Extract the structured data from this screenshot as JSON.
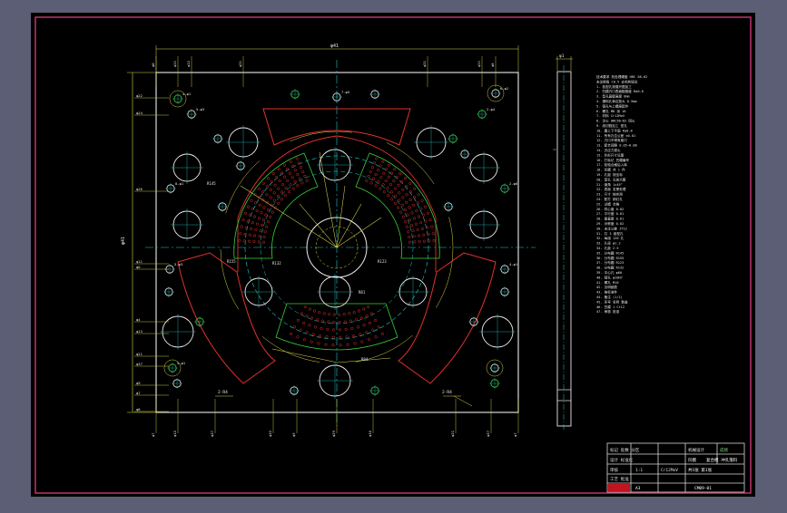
{
  "drawing": {
    "top_width_dim": "φ41",
    "side_width_dim": "φ1",
    "left_height_dim": "φ41",
    "left_bottom_label": "2-R4",
    "right_bottom_label": "2-R4",
    "left_dims": [
      "φ22",
      "φ24",
      "φ26",
      "φ11",
      "φ6",
      "φ4",
      "φ13",
      "φ21",
      "φ37",
      "φ9",
      "φ7",
      "φ8"
    ],
    "top_dims": [
      "φ8",
      "φ11",
      "φ12",
      "φ21",
      "φ21",
      "φ11",
      "φ8"
    ],
    "bottom_dims": [
      "φ7",
      "φ12",
      "φ27",
      "φ22",
      "φ9",
      "φ29",
      "φ10",
      "φ21",
      "φ27",
      "φ7"
    ],
    "hole_labels": [
      "4-φ1",
      "6-φ2",
      "5-φ3",
      "2-φ4",
      "7-φ5",
      "8-φ1",
      "2-φ6",
      "5-φ3",
      "4-φ1",
      "5-φ1"
    ],
    "center_dims": [
      "R145",
      "R155",
      "R123",
      "R132",
      "R81",
      "R84"
    ],
    "notes": [
      "技术要求 热处理硬度 HRC 58-62",
      "未注倒角 C0.5 去毛刺锐边",
      "1. 各型孔按展开图加工",
      "2. 凹模刃口表面粗糙度 Ra0.8",
      "3. 型孔直壁高度 8mm",
      "4. 漏料孔单边放大 0.5mm",
      "5. 销孔与上模座配作",
      "6. 螺孔 M8 深 16",
      "7. 材料 Cr12MoV",
      "8. 淬火 HRC58~62 回火",
      "9. 线切割加工 型孔",
      "10. 磨上下平面 Ra0.8",
      "11. 所有孔位公差 ±0.01",
      "12. 刃口不得有崩刃",
      "13. 配合间隙 0.05~0.08",
      "14. 去应力退火",
      "15. 外形尺寸见图",
      "16. 打标记 凹模编号",
      "17. 检验合格后入库",
      "18. 凹模 共 1 件",
      "19. 孔距 按坐标",
      "20. 型孔 见放大图",
      "21. 倒角 1×45°",
      "22. 表面 发黑处理",
      "23. 尺寸 按实测",
      "24. 配打 销钉孔",
      "25. 试模 合格",
      "26. 同心度 0.02",
      "27. 平行度 0.01",
      "28. 垂直度 0.01",
      "29. 对称度 0.02",
      "30. 未注公差 IT12",
      "31. 共 3 组型孔",
      "32. 每组 120 孔",
      "33. 孔径 φ1.2",
      "34. 孔距 2.5",
      "35. 分布圆 R145",
      "36. 分布圆 R155",
      "37. 分布圆 R123",
      "38. 分布圆 R132",
      "39. 中心孔 φ60",
      "40. 销孔 φ10H7",
      "41. 螺孔 M10",
      "42. 见明细表",
      "43. 按标准件",
      "44. 备注 (1/1)",
      "45. 序号 名称 数量",
      "46. 凹模 1 Cr12",
      "47. 审核 批准"
    ],
    "title_block": {
      "rows": [
        "标记 处数 分区",
        "设计 标准化",
        "审核",
        "工艺 批准"
      ],
      "part_name": "凹模",
      "subtitle": "复合模 冲孔落料",
      "scale": "1:1",
      "sheet": "共1张 第1张",
      "company": "机械设计",
      "drawing_no": "CM09-01",
      "material": "Cr12MoV",
      "school": "成绩",
      "mark": "A3"
    }
  }
}
